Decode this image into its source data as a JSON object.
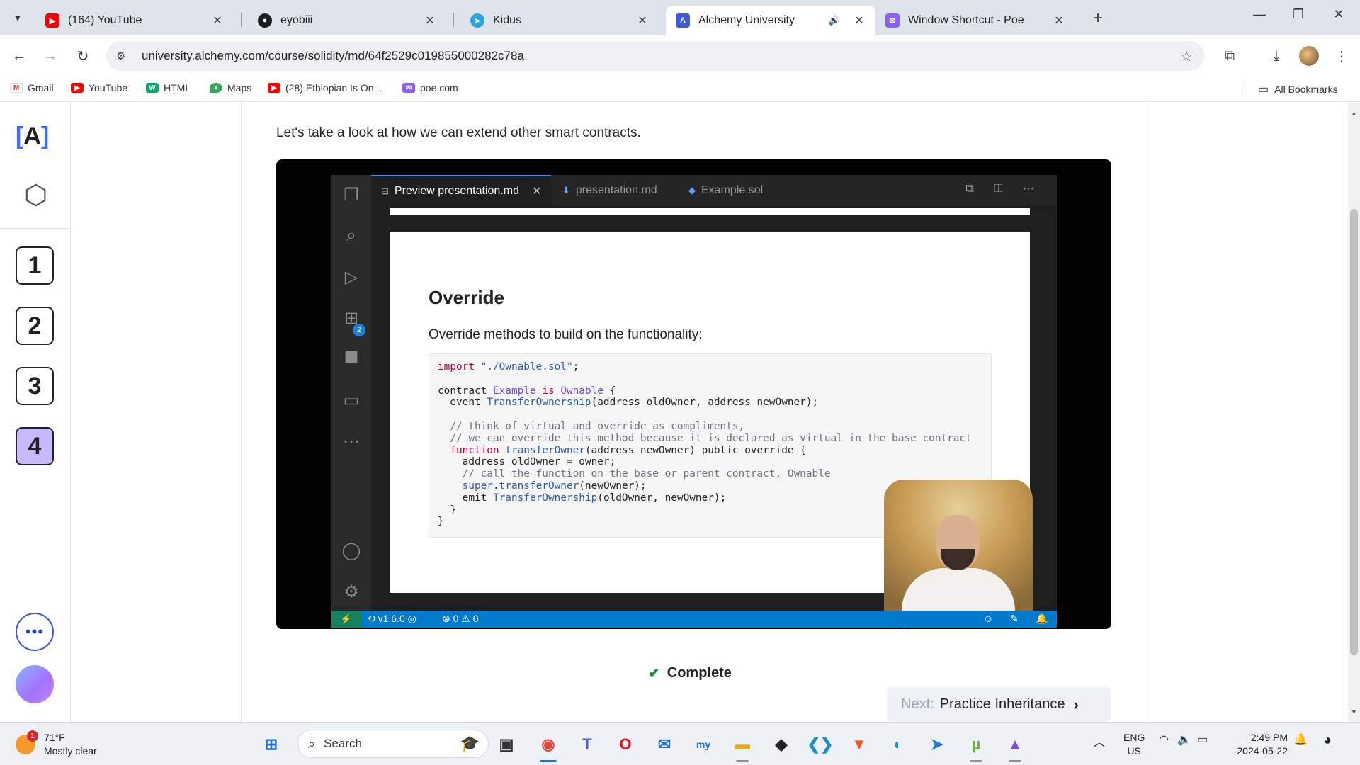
{
  "browser": {
    "tabs": [
      {
        "title": "(164) YouTube",
        "icon": "youtube-icon",
        "color": "#ff0000",
        "active": false
      },
      {
        "title": "eyobiii",
        "icon": "github-icon",
        "color": "#1b1f23",
        "active": false
      },
      {
        "title": "Kidus",
        "icon": "telegram-icon",
        "color": "#2aa3e0",
        "active": false
      },
      {
        "title": "Alchemy University",
        "icon": "alchemy-icon",
        "color": "#3f5bd8",
        "active": true
      },
      {
        "title": "Window Shortcut - Poe",
        "icon": "poe-icon",
        "color": "#8b5cf6",
        "active": false
      }
    ],
    "url": "university.alchemy.com/course/solidity/md/64f2529c019855000282c78a"
  },
  "bookmarks": [
    {
      "label": "Gmail",
      "icon": "gmail-icon",
      "color": "#d93025"
    },
    {
      "label": "YouTube",
      "icon": "youtube-icon",
      "color": "#ff0000"
    },
    {
      "label": "HTML",
      "icon": "w3-icon",
      "color": "#04aa6d"
    },
    {
      "label": "Maps",
      "icon": "maps-icon",
      "color": "#34a853"
    },
    {
      "label": "(28) Ethiopian Is On...",
      "icon": "youtube-icon",
      "color": "#ff0000"
    },
    {
      "label": "poe.com",
      "icon": "poe-icon",
      "color": "#8b5cf6"
    }
  ],
  "all_bookmarks": "All Bookmarks",
  "sidebar": {
    "logo": "A",
    "steps": [
      "1",
      "2",
      "3",
      "4"
    ],
    "active_step": "4"
  },
  "content": {
    "intro": "Let's take a look at how we can extend other smart contracts.",
    "complete_label": "Complete",
    "next_prefix": "Next:",
    "next_lesson": "Practice Inheritance"
  },
  "video": {
    "tabs": [
      {
        "label": "Preview presentation.md",
        "icon": "preview-icon"
      },
      {
        "label": "presentation.md",
        "icon": "markdown-icon"
      },
      {
        "label": "Example.sol",
        "icon": "solidity-icon"
      }
    ],
    "slide_title": "Override",
    "slide_subtitle": "Override methods to build on the functionality:",
    "status_version": "v1.6.0",
    "status_errors": "0",
    "status_warnings": "0",
    "extensions_badge": "2"
  },
  "taskbar": {
    "temperature": "71°F",
    "weather": "Mostly clear",
    "weather_badge": "1",
    "search_placeholder": "Search",
    "lang_1": "ENG",
    "lang_2": "US",
    "time": "2:49 PM",
    "date": "2024-05-22"
  }
}
